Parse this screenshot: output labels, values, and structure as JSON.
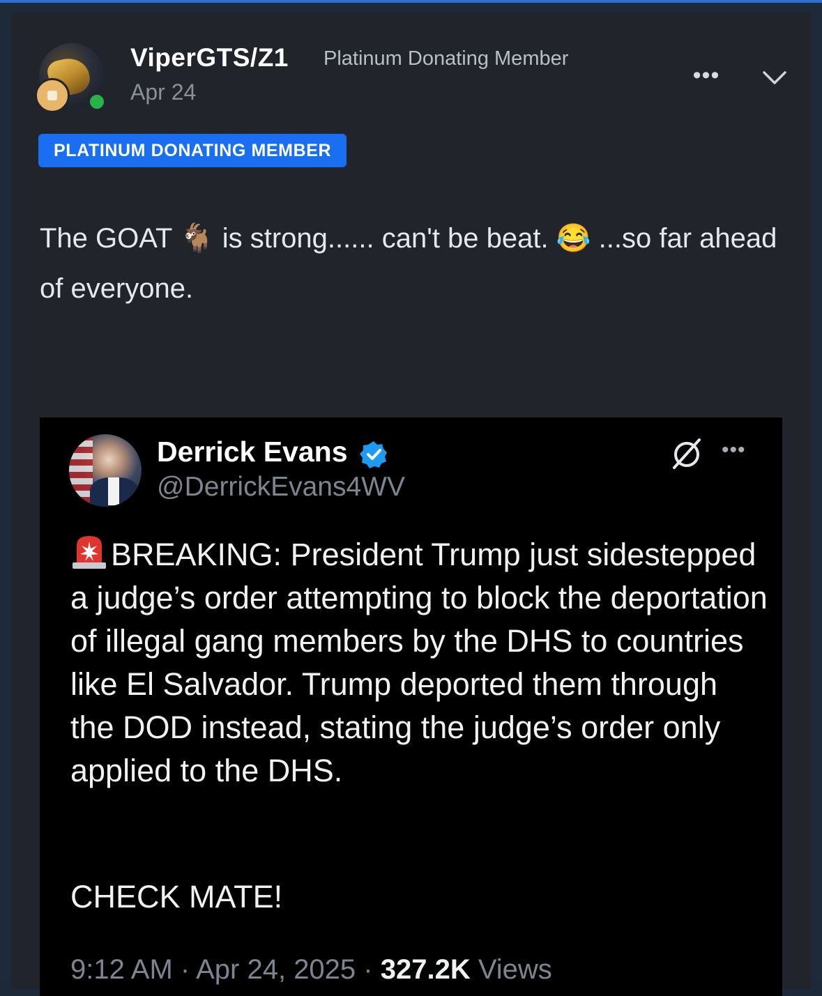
{
  "post": {
    "username": "ViperGTS/Z1",
    "user_title": "Platinum Donating Member",
    "date": "Apr 24",
    "role_badge": "PLATINUM DONATING MEMBER",
    "more_label": "•••",
    "message": {
      "part1": "The GOAT ",
      "emoji_goat": "🐐",
      "part2": " is strong...... can't be beat. ",
      "emoji_laugh": "😂",
      "part3": " ...so far ahead of everyone."
    },
    "icons": {
      "more": "more-horizontal-icon",
      "expand": "chevron-down-icon"
    }
  },
  "tweet": {
    "name": "Derrick Evans",
    "handle": "@DerrickEvans4WV",
    "more_label": "•••",
    "body": "BREAKING: President Trump just sidestepped a judge’s order attempting to block the deportation of illegal gang members by the DHS to countries like El Salvador. Trump deported them through the DOD instead, stating the judge’s order only applied to the DHS.",
    "check": "CHECK MATE!",
    "time": "9:12 AM",
    "sep1": " · ",
    "date": "Apr 24, 2025",
    "sep2": " · ",
    "views_count": "327.2K",
    "views_label": " Views",
    "icons": {
      "verified": "verified-badge-icon",
      "grok": "grok-icon",
      "siren": "siren-emoji-icon"
    }
  },
  "colors": {
    "accent_blue": "#1a6ff0",
    "online_green": "#27b34a",
    "verified_blue": "#1d9bf0"
  }
}
